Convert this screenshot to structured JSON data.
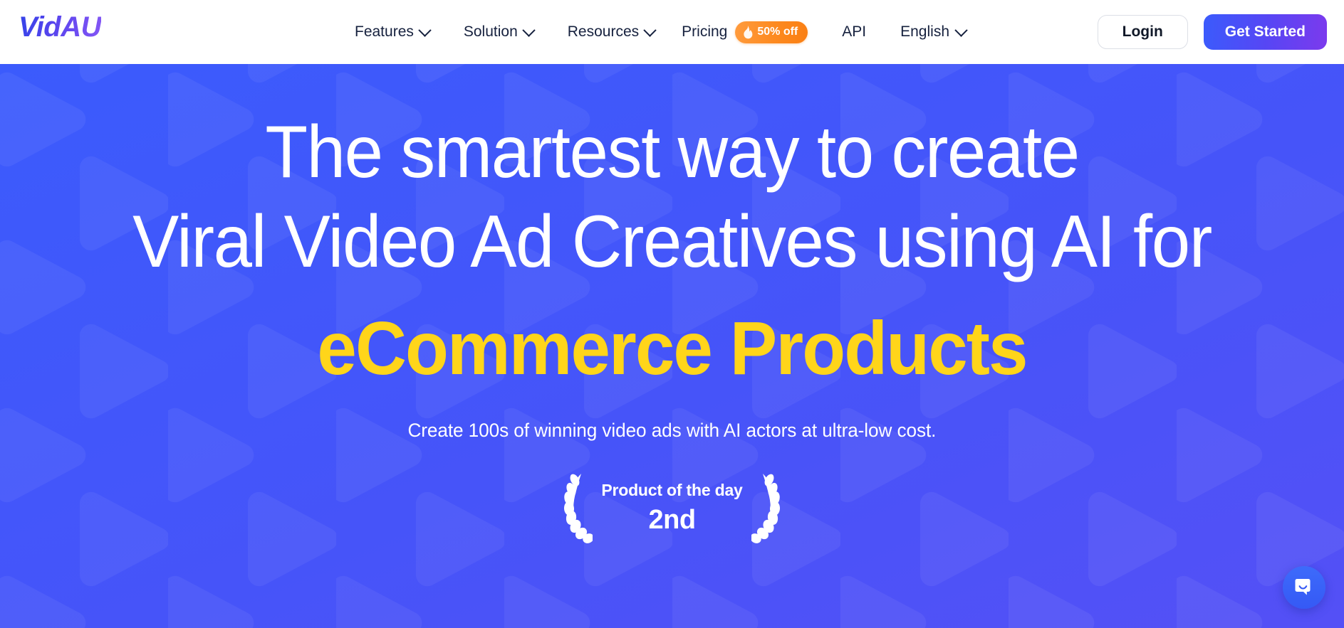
{
  "brand": {
    "name": "VidAU"
  },
  "header": {
    "nav": [
      {
        "label": "Features",
        "has_dropdown": true,
        "icon": "chevron-down-icon"
      },
      {
        "label": "Solution",
        "has_dropdown": true,
        "icon": "chevron-down-icon"
      },
      {
        "label": "Resources",
        "has_dropdown": true,
        "icon": "chevron-down-icon"
      }
    ],
    "pricing": {
      "label": "Pricing",
      "badge_text": "50% off",
      "badge_icon": "flame-icon",
      "badge_color": "#fb8b21"
    },
    "api_label": "API",
    "language": {
      "label": "English",
      "icon": "chevron-down-icon"
    },
    "login_label": "Login",
    "get_started_label": "Get Started"
  },
  "hero": {
    "headline_line1": "The smartest way to create",
    "headline_line2": "Viral Video Ad Creatives using AI for",
    "headline_accent": "eCommerce Products",
    "accent_color": "#FFD51A",
    "subtitle": "Create 100s of winning video ads with AI actors at ultra-low cost.",
    "product_hunt": {
      "title": "Product of the day",
      "rank": "2nd",
      "left_icon": "laurel-left-icon",
      "right_icon": "laurel-right-icon"
    },
    "background_color": "#3b5bfc"
  },
  "chat": {
    "icon": "chat-bubble-icon",
    "color": "#3559f5"
  }
}
